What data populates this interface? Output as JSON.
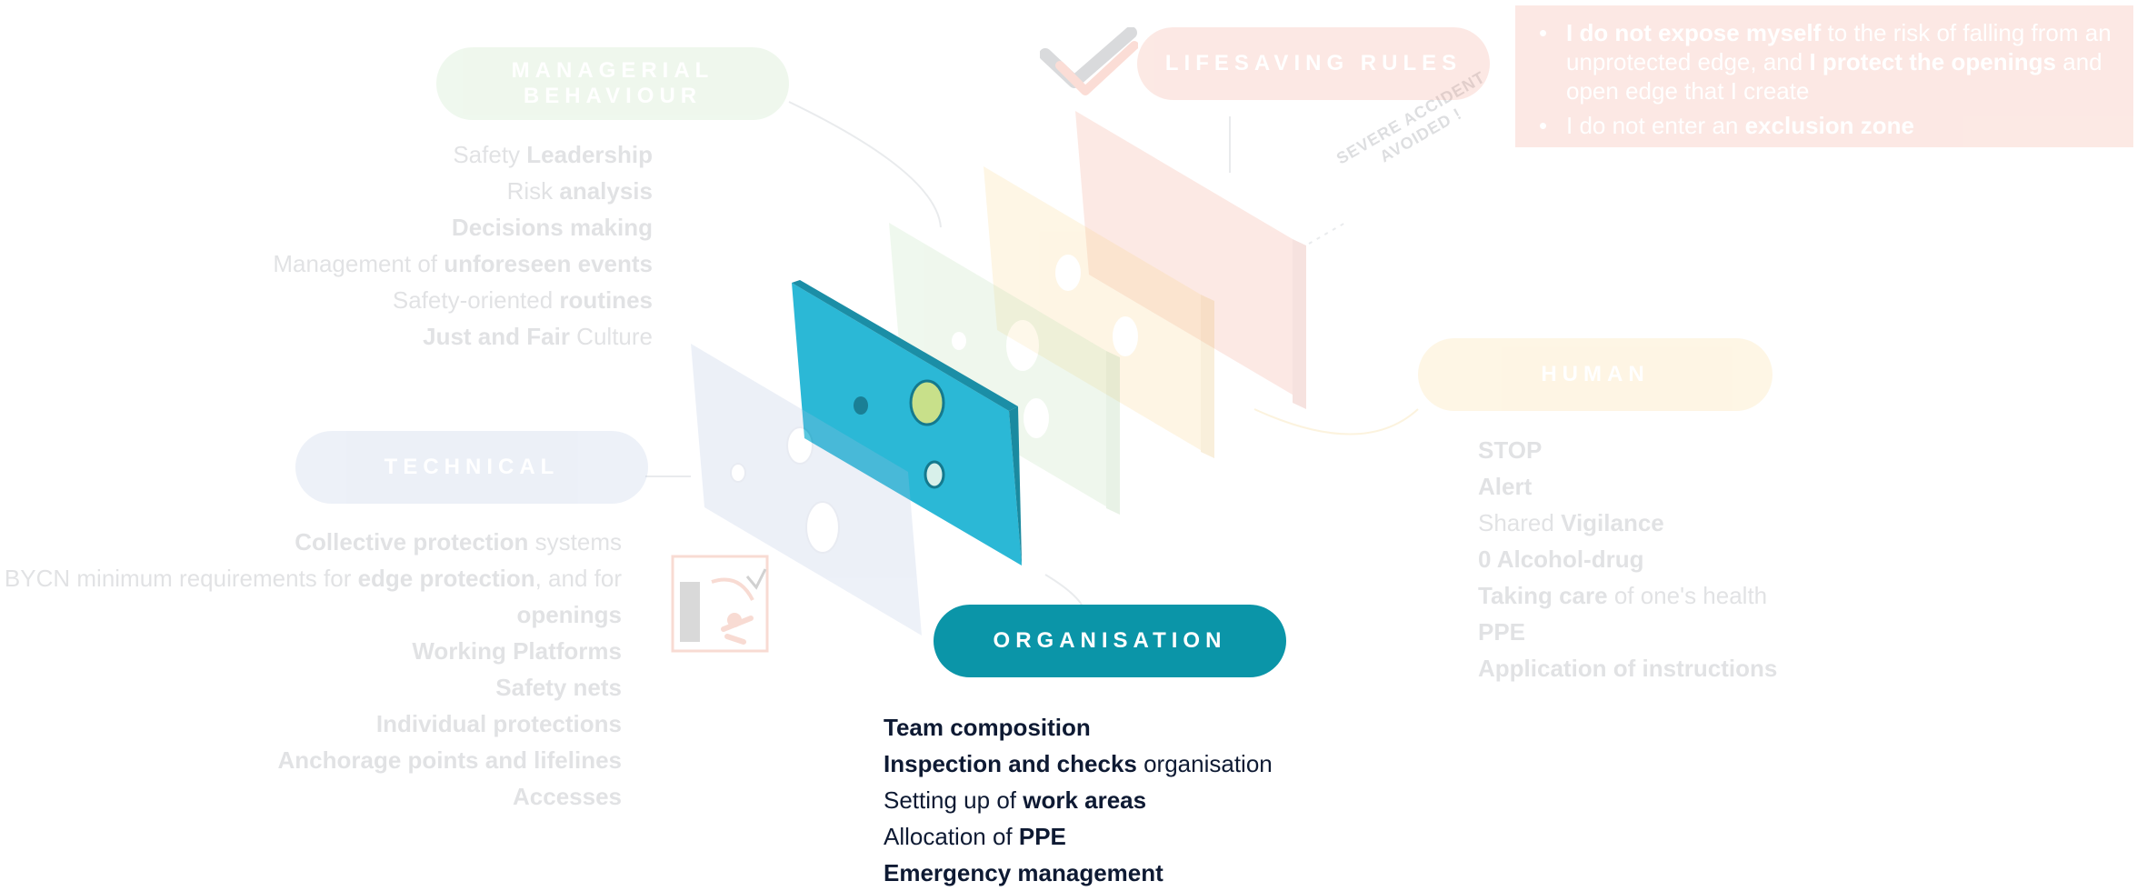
{
  "colors": {
    "managerial": "#b8dfb0",
    "lifesaving": "#f39a86",
    "human": "#fbd68a",
    "technical": "#aebedf",
    "organisation": "#0b95a8",
    "organisation_plate": "#2bb8d6",
    "text_dark": "#0e1a33"
  },
  "managerial": {
    "title": "MANAGERIAL BEHAVIOUR",
    "items": [
      [
        {
          "t": "Safety ",
          "b": false
        },
        {
          "t": "Leadership",
          "b": true
        }
      ],
      [
        {
          "t": "Risk ",
          "b": false
        },
        {
          "t": "analysis",
          "b": true
        }
      ],
      [
        {
          "t": "Decisions making",
          "b": true
        }
      ],
      [
        {
          "t": "Management of ",
          "b": false
        },
        {
          "t": "unforeseen events",
          "b": true
        }
      ],
      [
        {
          "t": "Safety-oriented ",
          "b": false
        },
        {
          "t": "routines",
          "b": true
        }
      ],
      [
        {
          "t": "Just and Fair",
          "b": true
        },
        {
          "t": " Culture",
          "b": false
        }
      ]
    ]
  },
  "lifesaving": {
    "title": "LIFESAVING RULES",
    "rules": [
      [
        {
          "t": "I do not expose myself",
          "b": true
        },
        {
          "t": " to the risk of falling from an unprotected edge, and ",
          "b": false
        },
        {
          "t": "I protect the openings",
          "b": true
        },
        {
          "t": " and open edge that I create",
          "b": false
        }
      ],
      [
        {
          "t": "I do not enter an ",
          "b": false
        },
        {
          "t": "exclusion zone",
          "b": true
        }
      ]
    ],
    "stamp": "SEVERE ACCIDENT AVOIDED !",
    "logo_icon": "check-logo-icon"
  },
  "human": {
    "title": "HUMAN",
    "items": [
      [
        {
          "t": "STOP",
          "b": true
        }
      ],
      [
        {
          "t": "Alert",
          "b": true
        }
      ],
      [
        {
          "t": "Shared ",
          "b": false
        },
        {
          "t": "Vigilance",
          "b": true
        }
      ],
      [
        {
          "t": "0 Alcohol-drug",
          "b": true
        }
      ],
      [
        {
          "t": "Taking care",
          "b": true
        },
        {
          "t": " of one's health",
          "b": false
        }
      ],
      [
        {
          "t": "PPE",
          "b": true
        }
      ],
      [
        {
          "t": "Application of instructions",
          "b": true
        }
      ]
    ]
  },
  "technical": {
    "title": "TECHNICAL",
    "items": [
      [
        {
          "t": "Collective protection",
          "b": true
        },
        {
          "t": " systems",
          "b": false
        }
      ],
      [
        {
          "t": "BYCN minimum requirements for ",
          "b": false
        },
        {
          "t": "edge protection",
          "b": true
        },
        {
          "t": ", and for",
          "b": false
        }
      ],
      [
        {
          "t": "openings",
          "b": true
        }
      ],
      [
        {
          "t": "Working Platforms",
          "b": true
        }
      ],
      [
        {
          "t": "Safety nets",
          "b": true
        }
      ],
      [
        {
          "t": "Individual protections",
          "b": true
        }
      ],
      [
        {
          "t": "Anchorage points and lifelines",
          "b": true
        }
      ],
      [
        {
          "t": "Accesses",
          "b": true
        }
      ]
    ],
    "illustration_icon": "falling-worker-icon"
  },
  "organisation": {
    "title": "ORGANISATION",
    "items": [
      [
        {
          "t": "Team composition",
          "b": true
        }
      ],
      [
        {
          "t": "Inspection and checks",
          "b": true
        },
        {
          "t": " organisation",
          "b": false
        }
      ],
      [
        {
          "t": "Setting up of ",
          "b": false
        },
        {
          "t": "work areas",
          "b": true
        }
      ],
      [
        {
          "t": "Allocation of ",
          "b": false
        },
        {
          "t": "PPE",
          "b": true
        }
      ],
      [
        {
          "t": "Emergency management",
          "b": true
        }
      ]
    ]
  }
}
